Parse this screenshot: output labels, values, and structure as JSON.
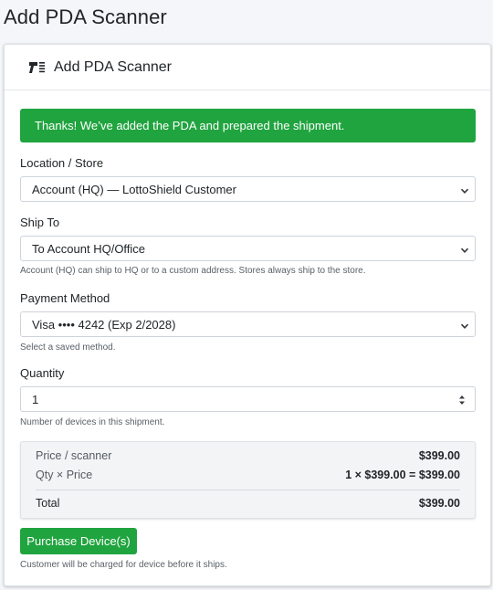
{
  "page": {
    "title": "Add PDA Scanner"
  },
  "card": {
    "title": "Add PDA Scanner",
    "icon": "barcode-scanner-icon"
  },
  "alert": {
    "message": "Thanks! We’ve added the PDA and prepared the shipment.",
    "color": "#20a43f"
  },
  "form": {
    "location": {
      "label": "Location / Store",
      "value": "Account (HQ) — LottoShield Customer"
    },
    "ship_to": {
      "label": "Ship To",
      "value": "To Account HQ/Office",
      "help": "Account (HQ) can ship to HQ or to a custom address. Stores always ship to the store."
    },
    "payment": {
      "label": "Payment Method",
      "value": "Visa •••• 4242 (Exp 2/2028)",
      "help": "Select a saved method."
    },
    "quantity": {
      "label": "Quantity",
      "value": "1",
      "help": "Number of devices in this shipment."
    }
  },
  "summary": {
    "price_label": "Price / scanner",
    "price_value": "$399.00",
    "qty_label": "Qty × Price",
    "qty_value": "1 × $399.00 = $399.00",
    "total_label": "Total",
    "total_value": "$399.00"
  },
  "actions": {
    "purchase_label": "Purchase Device(s)",
    "note": "Customer will be charged for device before it ships."
  }
}
